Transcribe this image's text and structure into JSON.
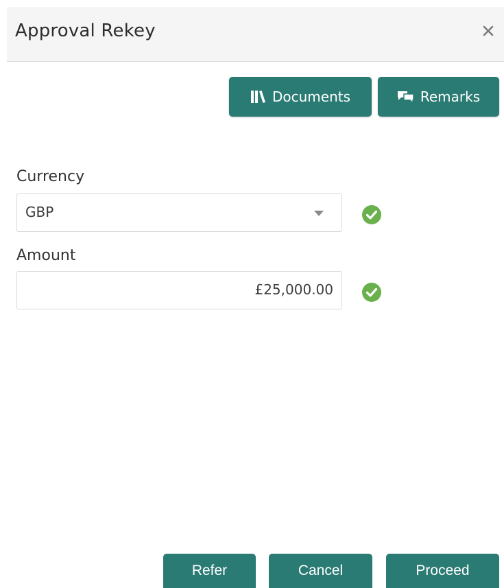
{
  "dialog": {
    "title": "Approval Rekey",
    "close_icon": "close-icon"
  },
  "toolbar": {
    "documents_label": "Documents",
    "documents_icon": "library-icon",
    "remarks_label": "Remarks",
    "remarks_icon": "chat-bubbles-icon"
  },
  "form": {
    "currency": {
      "label": "Currency",
      "value": "GBP",
      "status_icon": "check-circle-icon"
    },
    "amount": {
      "label": "Amount",
      "value": "£25,000.00",
      "status_icon": "check-circle-icon"
    }
  },
  "footer": {
    "refer_label": "Refer",
    "cancel_label": "Cancel",
    "proceed_label": "Proceed"
  },
  "colors": {
    "primary": "#2a7b73",
    "success": "#6ab04c",
    "header_bg": "#f5f5f5"
  }
}
